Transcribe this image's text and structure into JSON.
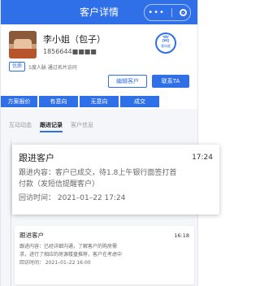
{
  "titlebar": {
    "title": "客户详情",
    "menu_dots": "•••"
  },
  "profile": {
    "name": "李小姐（包子）",
    "phone": "1856644■■■■",
    "level_big": "高",
    "level_small": "意向度",
    "tag_label": "优质",
    "source_text": "1度人脉  通过名片访问",
    "edit_button": "编辑客户",
    "contact_button": "联系TA"
  },
  "stages": [
    "方案报价",
    "有意向",
    "无意向",
    "成交"
  ],
  "tabs": [
    "互动动态",
    "跟进记录",
    "客户信息"
  ],
  "cards": [
    {
      "title": "跟进客户",
      "time": "17:24",
      "content_line1": "跟进内容：客户已成交，待1.8上午银行面签打首",
      "content_line2": "付款（发短信提醒客户）",
      "return_visit": "回访时间：  2021–01–22  17:24"
    },
    {
      "title": "跟进客户",
      "time": "16:18",
      "content_line1": "跟进内容：已经详细沟通，了解客户的购房需",
      "content_line2": "求，进行了相应的房源楼盘推荐，客户在考虑中",
      "return_visit": "回访时间：  2021–01–22  16:00"
    }
  ],
  "colors": {
    "primary": "#2f6fe8",
    "background": "#f4f6fa"
  }
}
